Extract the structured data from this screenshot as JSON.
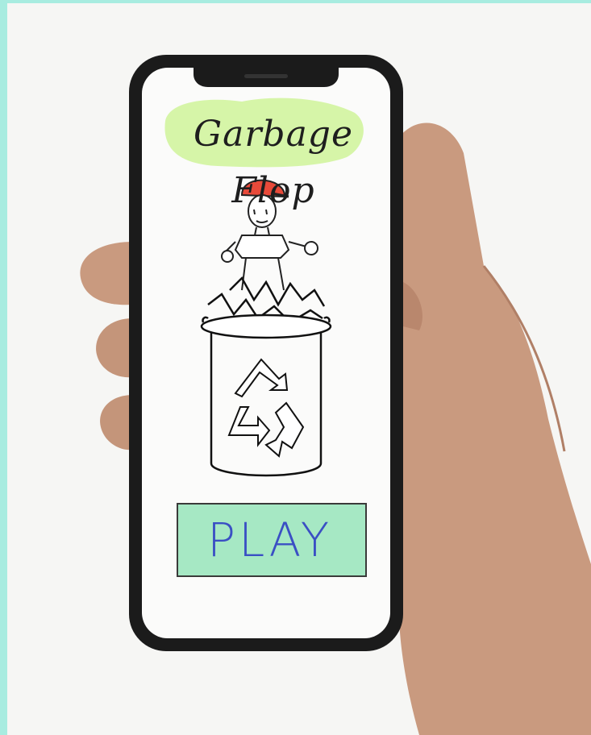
{
  "game": {
    "title": "Garbage Flop",
    "play_label": "PLAY"
  },
  "colors": {
    "border_accent": "#a8ece0",
    "title_highlight": "#d6f5a8",
    "play_button_bg": "#a6e8c4",
    "play_text": "#3a4fc4",
    "cap": "#e84a3a"
  },
  "icons": [
    "recycle-icon"
  ]
}
